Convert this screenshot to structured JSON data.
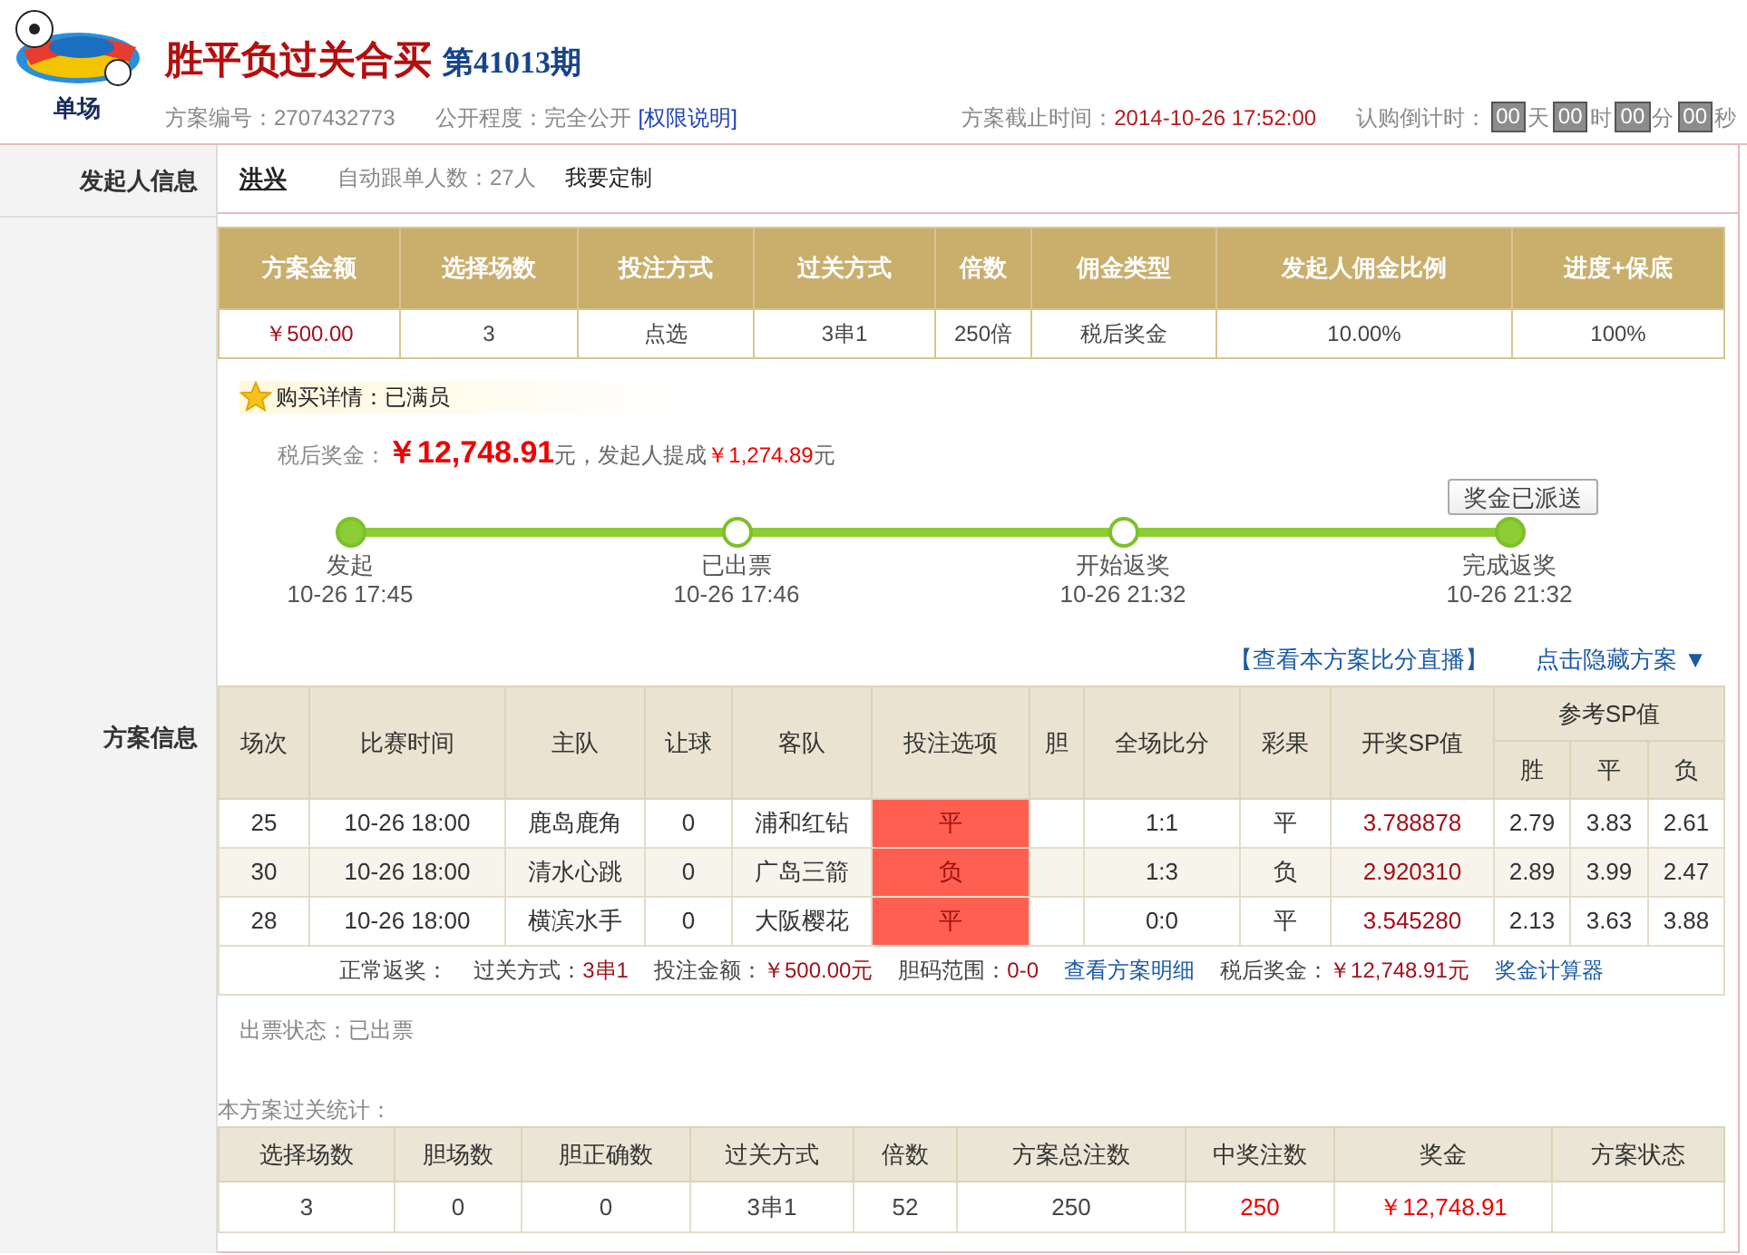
{
  "header": {
    "logo_label": "单场",
    "title": "胜平负过关合买",
    "issue": "第41013期",
    "plan_no_label": "方案编号：",
    "plan_no": "2707432773",
    "public_label": "公开程度：",
    "public_value": "完全公开",
    "permission_link": "[权限说明]",
    "deadline_label": "方案截止时间：",
    "deadline": "2014-10-26 17:52:00",
    "countdown_label": "认购倒计时：",
    "countdown": [
      {
        "value": "00",
        "unit": "天"
      },
      {
        "value": "00",
        "unit": "时"
      },
      {
        "value": "00",
        "unit": "分"
      },
      {
        "value": "00",
        "unit": "秒"
      }
    ]
  },
  "sponsor": {
    "label": "发起人信息",
    "name": "洪兴",
    "followers": "自动跟单人数：27人",
    "customize": "我要定制"
  },
  "plan_section": {
    "label": "方案信息"
  },
  "summary_table": {
    "columns": [
      "方案金额",
      "选择场数",
      "投注方式",
      "过关方式",
      "倍数",
      "佣金类型",
      "发起人佣金比例",
      "进度+保底"
    ],
    "row": [
      "￥500.00",
      "3",
      "点选",
      "3串1",
      "250倍",
      "税后奖金",
      "10.00%",
      "100%"
    ]
  },
  "purchase": {
    "label": "购买详情：",
    "value": "已满员"
  },
  "prize": {
    "label": "税后奖金：",
    "amount": "￥12,748.91",
    "mid": "元，发起人提成",
    "commission": "￥1,274.89",
    "unit": "元"
  },
  "dispatch_button": "奖金已派送",
  "timeline": [
    {
      "label": "发起",
      "time": "10-26 17:45",
      "filled": true
    },
    {
      "label": "已出票",
      "time": "10-26 17:46",
      "filled": false
    },
    {
      "label": "开始返奖",
      "time": "10-26 21:32",
      "filled": false
    },
    {
      "label": "完成返奖",
      "time": "10-26 21:32",
      "filled": true
    }
  ],
  "links": {
    "live": "【查看本方案比分直播】",
    "hide": "点击隐藏方案 ▼"
  },
  "match_table": {
    "columns": [
      "场次",
      "比赛时间",
      "主队",
      "让球",
      "客队",
      "投注选项",
      "胆",
      "全场比分",
      "彩果",
      "开奖SP值"
    ],
    "sp_group": "参考SP值",
    "sp_columns": [
      "胜",
      "平",
      "负"
    ],
    "rows": [
      {
        "no": "25",
        "time": "10-26 18:00",
        "home": "鹿岛鹿角",
        "handicap": "0",
        "away": "浦和红钻",
        "bet": "平",
        "bet_hit": true,
        "score": "1:1",
        "result": "平",
        "sp": "3.788878",
        "ref": [
          "2.79",
          "3.83",
          "2.61"
        ]
      },
      {
        "no": "30",
        "time": "10-26 18:00",
        "home": "清水心跳",
        "handicap": "0",
        "away": "广岛三箭",
        "bet": "负",
        "bet_hit": true,
        "score": "1:3",
        "result": "负",
        "sp": "2.920310",
        "ref": [
          "2.89",
          "3.99",
          "2.47"
        ]
      },
      {
        "no": "28",
        "time": "10-26 18:00",
        "home": "横滨水手",
        "handicap": "0",
        "away": "大阪樱花",
        "bet": "平",
        "bet_hit": true,
        "score": "0:0",
        "result": "平",
        "sp": "3.545280",
        "ref": [
          "2.13",
          "3.63",
          "3.88"
        ]
      }
    ],
    "footer": {
      "status": "正常返奖：",
      "pass_label": "过关方式：",
      "pass_value": "3串1",
      "amount_label": "投注金额：",
      "amount_value": "￥500.00元",
      "banker_label": "胆码范围：",
      "banker_value": "0-0",
      "detail_link": "查看方案明细",
      "prize_label": "税后奖金：",
      "prize_value": "￥12,748.91元",
      "calc_link": "奖金计算器"
    }
  },
  "ticket_status": "出票状态：已出票",
  "stats": {
    "title": "本方案过关统计：",
    "columns": [
      "选择场数",
      "胆场数",
      "胆正确数",
      "过关方式",
      "倍数",
      "方案总注数",
      "中奖注数",
      "奖金",
      "方案状态"
    ],
    "row": [
      {
        "text": "3",
        "emphasis": false
      },
      {
        "text": "0",
        "emphasis": false
      },
      {
        "text": "0",
        "emphasis": false
      },
      {
        "text": "3串1",
        "emphasis": false
      },
      {
        "text": "52",
        "emphasis": false
      },
      {
        "text": "250",
        "emphasis": false
      },
      {
        "text": "250",
        "emphasis": true
      },
      {
        "text": "￥12,748.91",
        "emphasis": true
      }
    ]
  }
}
